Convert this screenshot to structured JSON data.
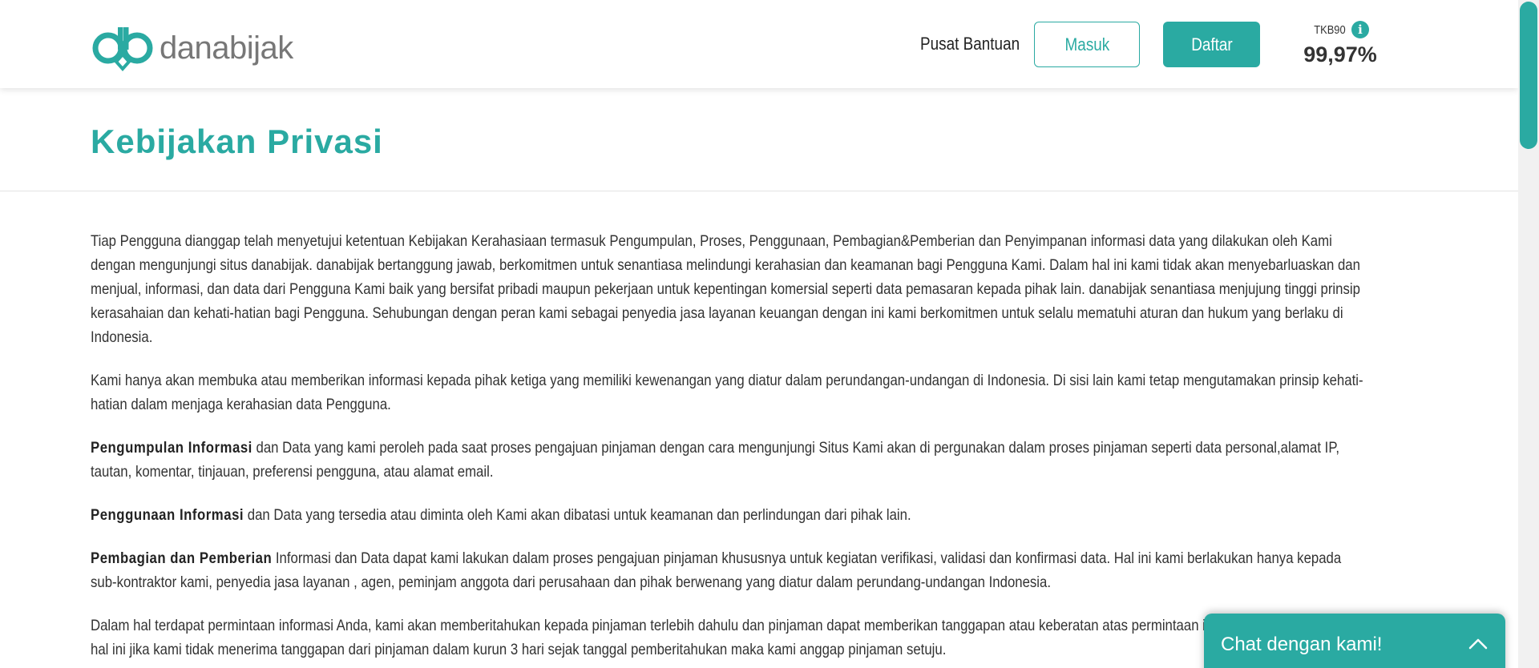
{
  "header": {
    "logo_text": "danabijak",
    "help_label": "Pusat Bantuan",
    "login_label": "Masuk",
    "register_label": "Daftar",
    "tkb_label": "TKB90",
    "tkb_value": "99,97%",
    "info_icon": "info-icon"
  },
  "title": "Kebijakan Privasi",
  "content": {
    "p1": "Tiap Pengguna dianggap telah menyetujui ketentuan Kebijakan Kerahasiaan termasuk Pengumpulan, Proses, Penggunaan, Pembagian&Pemberian dan Penyimpanan informasi data yang dilakukan oleh Kami dengan mengunjungi situs danabijak. danabijak bertanggung jawab, berkomitmen untuk senantiasa melindungi kerahasian dan keamanan bagi Pengguna Kami. Dalam hal ini kami tidak akan menyebarluaskan dan menjual, informasi, dan data dari Pengguna Kami baik yang bersifat pribadi maupun pekerjaan untuk kepentingan komersial seperti data pemasaran kepada pihak lain. danabijak senantiasa menjujung tinggi prinsip kerasahaian dan kehati-hatian bagi Pengguna. Sehubungan dengan peran kami sebagai penyedia jasa layanan keuangan dengan ini kami berkomitmen untuk selalu mematuhi aturan dan hukum yang berlaku di Indonesia.",
    "p2": "Kami hanya akan membuka atau memberikan informasi kepada pihak ketiga yang memiliki kewenangan yang diatur dalam perundangan-undangan di Indonesia. Di sisi lain kami tetap mengutamakan prinsip kehati-hatian dalam menjaga kerahasian data Pengguna.",
    "p3_heading": "Pengumpulan Informasi",
    "p3_text": " dan Data yang kami peroleh pada saat proses pengajuan pinjaman dengan cara mengunjungi Situs Kami akan di pergunakan dalam proses pinjaman seperti data personal,alamat IP, tautan, komentar, tinjauan, preferensi pengguna, atau alamat email.",
    "p4_heading": "Penggunaan Informasi",
    "p4_text": " dan Data yang tersedia atau diminta oleh Kami akan dibatasi untuk keamanan dan perlindungan dari pihak lain.",
    "p5_heading": "Pembagian dan Pemberian",
    "p5_text": " Informasi dan Data dapat kami lakukan dalam proses pengajuan pinjaman khususnya untuk kegiatan verifikasi, validasi dan konfirmasi data. Hal ini kami berlakukan hanya kepada sub-kontraktor kami, penyedia jasa layanan , agen, peminjam anggota dari perusahaan dan pihak berwenang yang diatur dalam perundang-undangan Indonesia.",
    "p6": "Dalam hal terdapat permintaan informasi Anda, kami akan memberitahukan kepada pinjaman terlebih dahulu dan pinjaman dapat memberikan tanggapan atau keberatan atas permintaan informasi tersebut. Dalam hal ini jika kami tidak menerima tanggapan dari pinjaman dalam kurun 3 hari sejak tanggal pemberitahukan maka kami anggap pinjaman setuju."
  },
  "chat": {
    "label": "Chat dengan kami!",
    "toggle_icon": "chevron-up-icon"
  },
  "colors": {
    "brand": "#2aaaa2",
    "text": "#333333"
  }
}
